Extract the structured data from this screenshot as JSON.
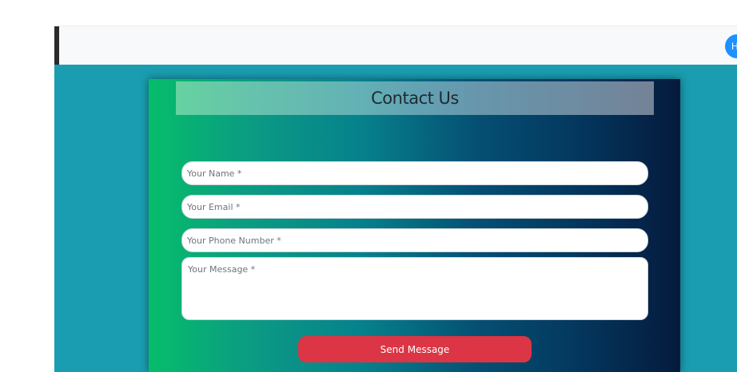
{
  "navbar": {
    "avatar_letter": "H",
    "accent": "#1e90ff"
  },
  "page": {
    "background": "#1a9db0"
  },
  "contact": {
    "title": "Contact Us",
    "fields": {
      "name_placeholder": "Your Name *",
      "email_placeholder": "Your Email *",
      "phone_placeholder": "Your Phone Number *",
      "message_placeholder": "Your Message *"
    },
    "send_label": "Send Message",
    "send_color": "#dc3545"
  }
}
